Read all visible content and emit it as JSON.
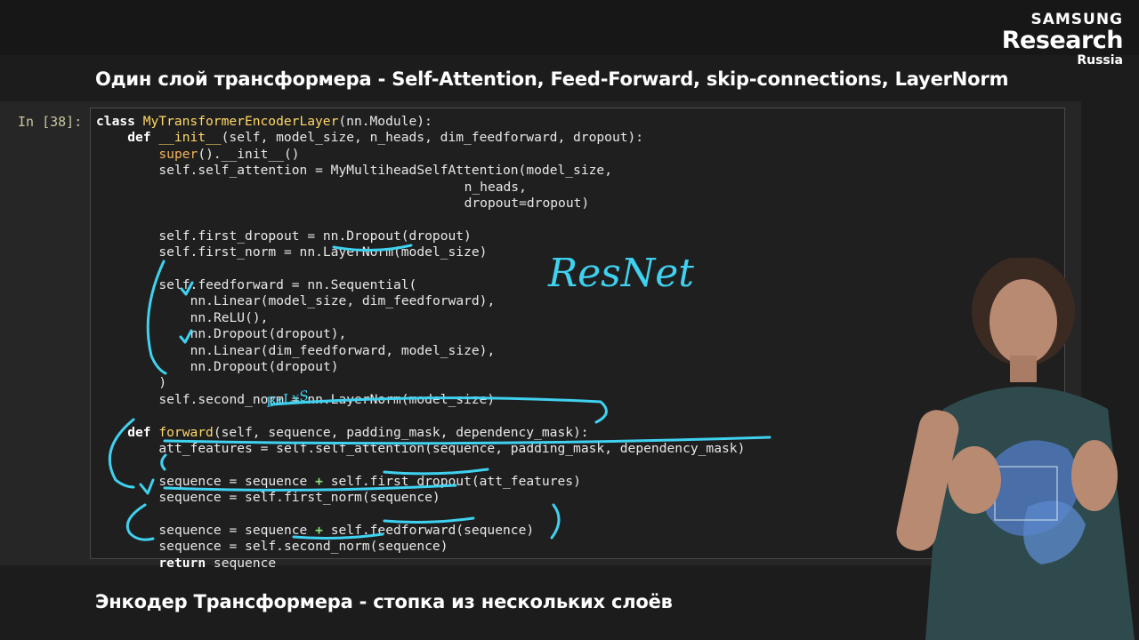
{
  "branding": {
    "line1": "SAMSUNG",
    "line2": "Research",
    "line3": "Russia"
  },
  "slide": {
    "title": "Один слой трансформера - Self-Attention, Feed-Forward, skip-connections, LayerNorm",
    "bottom_title": "Энкодер Трансформера - стопка из нескольких слоёв"
  },
  "notebook": {
    "prompt": "In [38]:",
    "code": [
      {
        "indent": 0,
        "segments": [
          {
            "t": "class ",
            "c": "kw"
          },
          {
            "t": "MyTransformerEncoderLayer",
            "c": "fn"
          },
          {
            "t": "(nn.Module):",
            "c": ""
          }
        ]
      },
      {
        "indent": 4,
        "segments": [
          {
            "t": "def ",
            "c": "kw"
          },
          {
            "t": "__init__",
            "c": "fn"
          },
          {
            "t": "(self, model_size, n_heads, dim_feedforward, dropout):",
            "c": ""
          }
        ]
      },
      {
        "indent": 8,
        "segments": [
          {
            "t": "super",
            "c": "bi"
          },
          {
            "t": "().__init__()",
            "c": ""
          }
        ]
      },
      {
        "indent": 8,
        "segments": [
          {
            "t": "self.self_attention = MyMultiheadSelfAttention(model_size,",
            "c": ""
          }
        ]
      },
      {
        "indent": 47,
        "segments": [
          {
            "t": "n_heads,",
            "c": ""
          }
        ]
      },
      {
        "indent": 47,
        "segments": [
          {
            "t": "dropout=dropout)",
            "c": ""
          }
        ]
      },
      {
        "indent": 0,
        "segments": []
      },
      {
        "indent": 8,
        "segments": [
          {
            "t": "self.first_dropout = nn.Dropout(dropout)",
            "c": ""
          }
        ]
      },
      {
        "indent": 8,
        "segments": [
          {
            "t": "self.first_norm = nn.LayerNorm(model_size)",
            "c": ""
          }
        ]
      },
      {
        "indent": 0,
        "segments": []
      },
      {
        "indent": 8,
        "segments": [
          {
            "t": "self.feedforward = nn.Sequential(",
            "c": ""
          }
        ]
      },
      {
        "indent": 12,
        "segments": [
          {
            "t": "nn.Linear(model_size, dim_feedforward),",
            "c": ""
          }
        ]
      },
      {
        "indent": 12,
        "segments": [
          {
            "t": "nn.ReLU(),",
            "c": ""
          }
        ]
      },
      {
        "indent": 12,
        "segments": [
          {
            "t": "nn.Dropout(dropout),",
            "c": ""
          }
        ]
      },
      {
        "indent": 12,
        "segments": [
          {
            "t": "nn.Linear(dim_feedforward, model_size),",
            "c": ""
          }
        ]
      },
      {
        "indent": 12,
        "segments": [
          {
            "t": "nn.Dropout(dropout)",
            "c": ""
          }
        ]
      },
      {
        "indent": 8,
        "segments": [
          {
            "t": ")",
            "c": ""
          }
        ]
      },
      {
        "indent": 8,
        "segments": [
          {
            "t": "self.second_norm = nn.LayerNorm(model_size)",
            "c": ""
          }
        ]
      },
      {
        "indent": 0,
        "segments": []
      },
      {
        "indent": 4,
        "segments": [
          {
            "t": "def ",
            "c": "kw"
          },
          {
            "t": "forward",
            "c": "fn"
          },
          {
            "t": "(self, sequence, padding_mask, dependency_mask):",
            "c": ""
          }
        ]
      },
      {
        "indent": 8,
        "segments": [
          {
            "t": "att_features = self.self_attention(sequence, padding_mask, dependency_mask)",
            "c": ""
          }
        ]
      },
      {
        "indent": 0,
        "segments": []
      },
      {
        "indent": 8,
        "segments": [
          {
            "t": "sequence = sequence ",
            "c": ""
          },
          {
            "t": "+",
            "c": "op"
          },
          {
            "t": " self.first_dropout(att_features)",
            "c": ""
          }
        ]
      },
      {
        "indent": 8,
        "segments": [
          {
            "t": "sequence = self.first_norm(sequence)",
            "c": ""
          }
        ]
      },
      {
        "indent": 0,
        "segments": []
      },
      {
        "indent": 8,
        "segments": [
          {
            "t": "sequence = sequence ",
            "c": ""
          },
          {
            "t": "+",
            "c": "op"
          },
          {
            "t": " self.feedforward(sequence)",
            "c": ""
          }
        ]
      },
      {
        "indent": 8,
        "segments": [
          {
            "t": "sequence = self.second_norm(sequence)",
            "c": ""
          }
        ]
      },
      {
        "indent": 8,
        "segments": [
          {
            "t": "return ",
            "c": "kw"
          },
          {
            "t": "sequence",
            "c": ""
          }
        ]
      }
    ]
  },
  "annotations": {
    "resnet": "ResNet",
    "batch_note": "BxLxS",
    "ink_color": "#3fd2f0"
  }
}
